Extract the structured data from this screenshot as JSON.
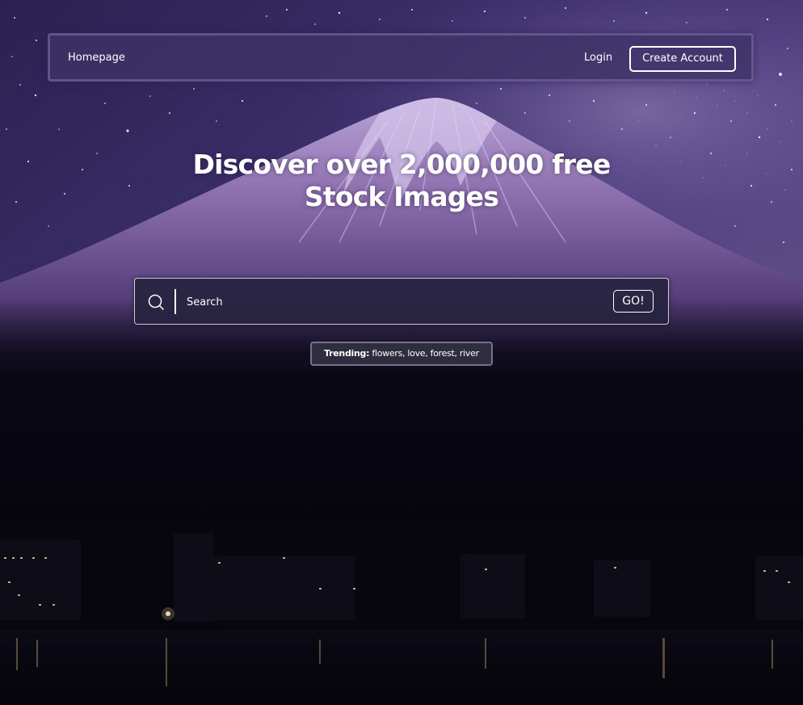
{
  "nav": {
    "home_label": "Homepage",
    "login_label": "Login",
    "create_account_label": "Create Account"
  },
  "hero": {
    "title_line1": "Discover over 2,000,000 free",
    "title_line2": "Stock Images"
  },
  "search": {
    "placeholder": "Search",
    "value": "",
    "icon": "search-icon",
    "go_label": "GO!"
  },
  "trending": {
    "label": "Trending:",
    "terms": "flowers, love, forest, river"
  },
  "colors": {
    "sky_top": "#3b2f6b",
    "sky_bottom": "#1a1433",
    "mountain": "#8a6aa8",
    "snow": "#cfc0e6",
    "foreground": "#07060f",
    "navbar_bg": "#3e3268",
    "search_bg": "#26223e",
    "text": "#ffffff"
  }
}
